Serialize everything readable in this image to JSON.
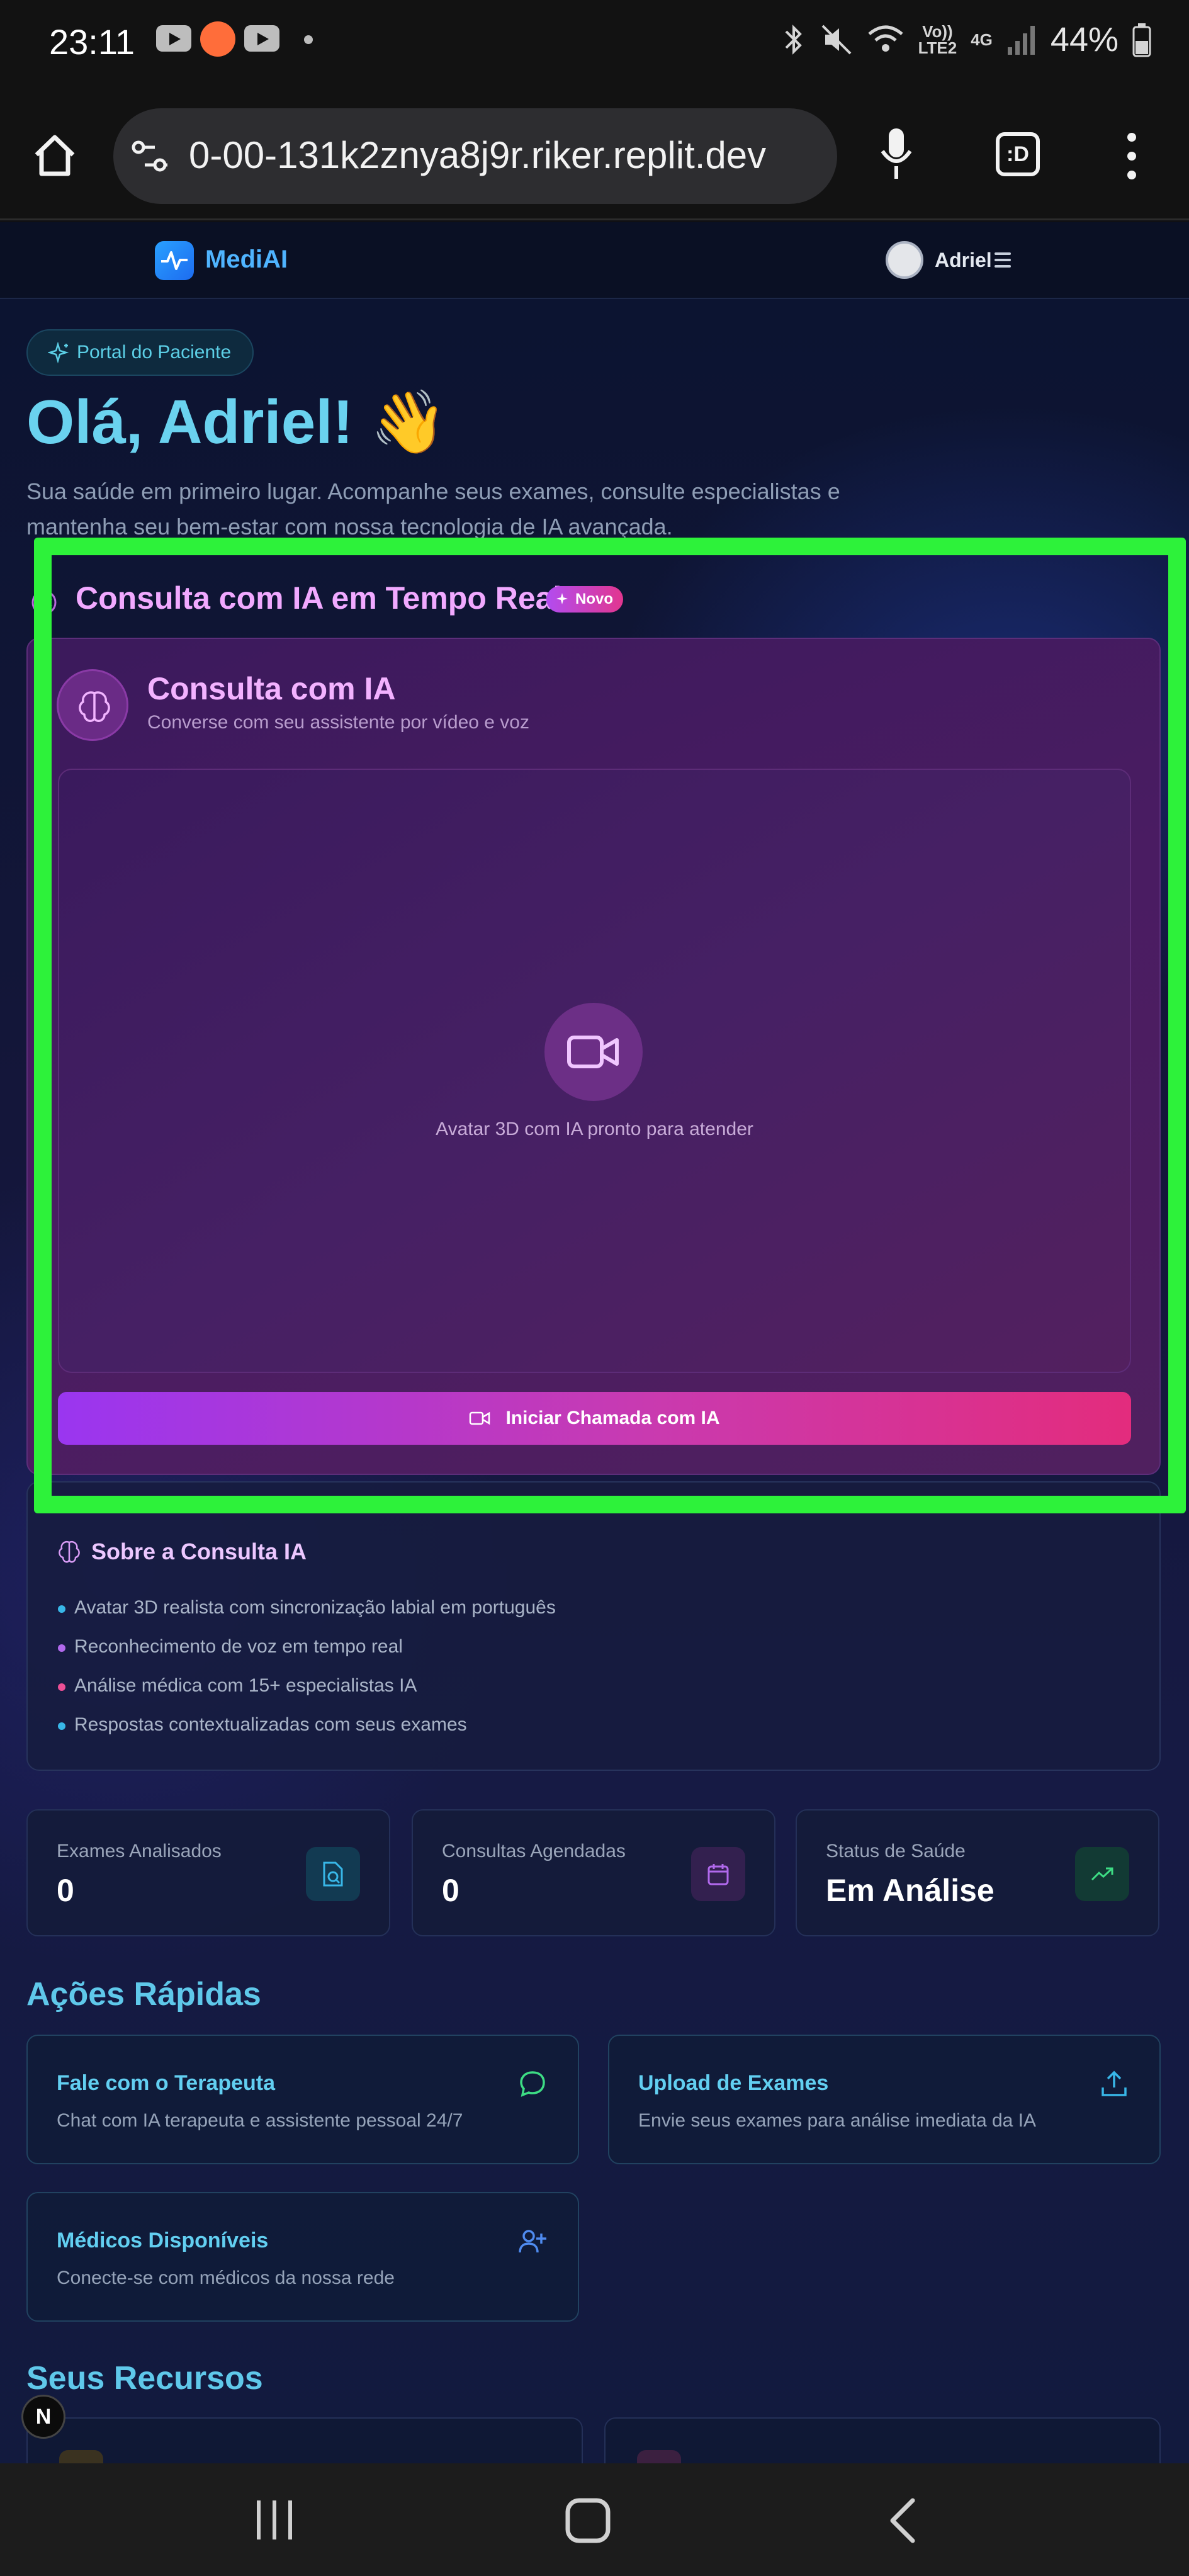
{
  "status_bar": {
    "time": "23:11",
    "network_top": "Vo))",
    "network_bottom": "LTE2",
    "network_type": "4G",
    "battery": "44%"
  },
  "browser": {
    "url": "0-00-131k2znya8j9r.riker.replit.dev",
    "tab_count": ":D"
  },
  "app": {
    "brand": "MediAI",
    "user_name": "Adriel",
    "portal_badge": "Portal do Paciente",
    "greeting": "Olá, Adriel! 👋",
    "subtitle": "Sua saúde em primeiro lugar. Acompanhe seus exames, consulte especialistas e mantenha seu bem-estar com nossa tecnologia de IA avançada.",
    "ai_section": {
      "title": "Consulta com IA em Tempo Real",
      "badge": "Novo",
      "card_title": "Consulta com IA",
      "card_subtitle": "Converse com seu assistente por vídeo e voz",
      "avatar_status": "Avatar 3D com IA pronto para atender",
      "call_button": "Iniciar Chamada com IA"
    },
    "about": {
      "title": "Sobre a Consulta IA",
      "items": [
        "Avatar 3D realista com sincronização labial em português",
        "Reconhecimento de voz em tempo real",
        "Análise médica com 15+ especialistas IA",
        "Respostas contextualizadas com seus exames"
      ],
      "dot_colors": [
        "#38b7e8",
        "#b169ec",
        "#ec4f95",
        "#38b7e8"
      ]
    },
    "stats": [
      {
        "label": "Exames Analisados",
        "value": "0",
        "icon": "scan-file-icon",
        "color": "#38b7e8",
        "bg": "#123a52"
      },
      {
        "label": "Consultas Agendadas",
        "value": "0",
        "icon": "calendar-icon",
        "color": "#b169ec",
        "bg": "#33204f"
      },
      {
        "label": "Status de Saúde",
        "value": "Em Análise",
        "icon": "trending-up-icon",
        "color": "#3ddc84",
        "bg": "#123a34"
      }
    ],
    "quick_actions_title": "Ações Rápidas",
    "quick_actions": [
      {
        "title": "Fale com o Terapeuta",
        "subtitle": "Chat com IA terapeuta e assistente pessoal 24/7",
        "icon": "chat-bubble-icon",
        "color": "#3ddc84"
      },
      {
        "title": "Upload de Exames",
        "subtitle": "Envie seus exames para análise imediata da IA",
        "icon": "upload-icon",
        "color": "#38b7e8"
      },
      {
        "title": "Médicos Disponíveis",
        "subtitle": "Conecte-se com médicos da nossa rede",
        "icon": "user-plus-icon",
        "color": "#4f8bf0"
      }
    ],
    "resources_title": "Seus Recursos",
    "next_badge": "N"
  }
}
